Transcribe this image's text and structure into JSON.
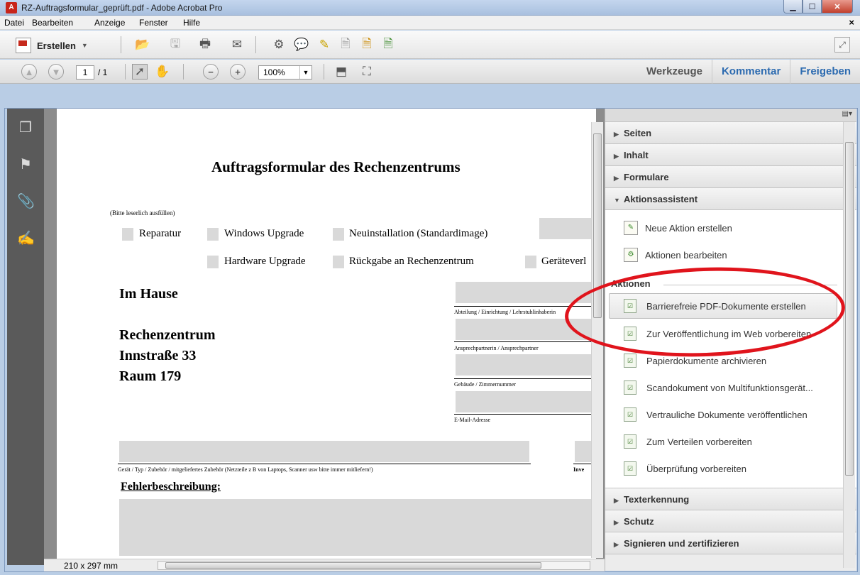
{
  "window": {
    "title": "RZ-Auftragsformular_geprüft.pdf - Adobe Acrobat Pro"
  },
  "menu": [
    "Datei",
    "Bearbeiten",
    "Anzeige",
    "Fenster",
    "Hilfe"
  ],
  "toolbar": {
    "create_label": "Erstellen",
    "page_current": "1",
    "page_total": "/ 1",
    "zoom": "100%"
  },
  "tabs": {
    "tools": "Werkzeuge",
    "comment": "Kommentar",
    "share": "Freigeben"
  },
  "document": {
    "heading": "Auftragsformular des Rechenzentrums",
    "hint": "(Bitte leserlich ausfüllen)",
    "options_row1": [
      "Reparatur",
      "Windows Upgrade",
      "Neuinstallation (Standardimage)"
    ],
    "options_row2": [
      "Hardware Upgrade",
      "Rückgabe an Rechenzentrum",
      "Geräteverl"
    ],
    "im_hause": "Im Hause",
    "address": [
      "Rechenzentrum",
      "Innstraße 33",
      "Raum 179"
    ],
    "field_labels": [
      "Abteilung / Einrichtung / Lehrstuhlinhaberin",
      "Ansprechpartnerin / Ansprechpartner",
      "Gebäude / Zimmernummer",
      "E-Mail-Adresse"
    ],
    "device_label": "Gerät / Typ / Zubehör / mitgeliefertes Zubehör (Netzteile z B  von Laptops, Scanner usw  bitte immer mitliefern!)",
    "inv_label": "Inve",
    "fault_heading": "Fehlerbeschreibung:"
  },
  "statusbar": {
    "page_size": "210 x 297 mm"
  },
  "panel": {
    "sections_top": [
      "Seiten",
      "Inhalt",
      "Formulare",
      "Aktionsassistent"
    ],
    "assistant_items": [
      "Neue Aktion erstellen",
      "Aktionen bearbeiten"
    ],
    "actions_header": "Aktionen",
    "actions": [
      "Barrierefreie PDF-Dokumente erstellen",
      "Zur Veröffentlichung im Web vorbereiten",
      "Papierdokumente archivieren",
      "Scandokument von Multifunktionsgerät...",
      "Vertrauliche Dokumente veröffentlichen",
      "Zum Verteilen vorbereiten",
      "Überprüfung vorbereiten"
    ],
    "sections_bottom": [
      "Texterkennung",
      "Schutz",
      "Signieren und zertifizieren"
    ]
  }
}
